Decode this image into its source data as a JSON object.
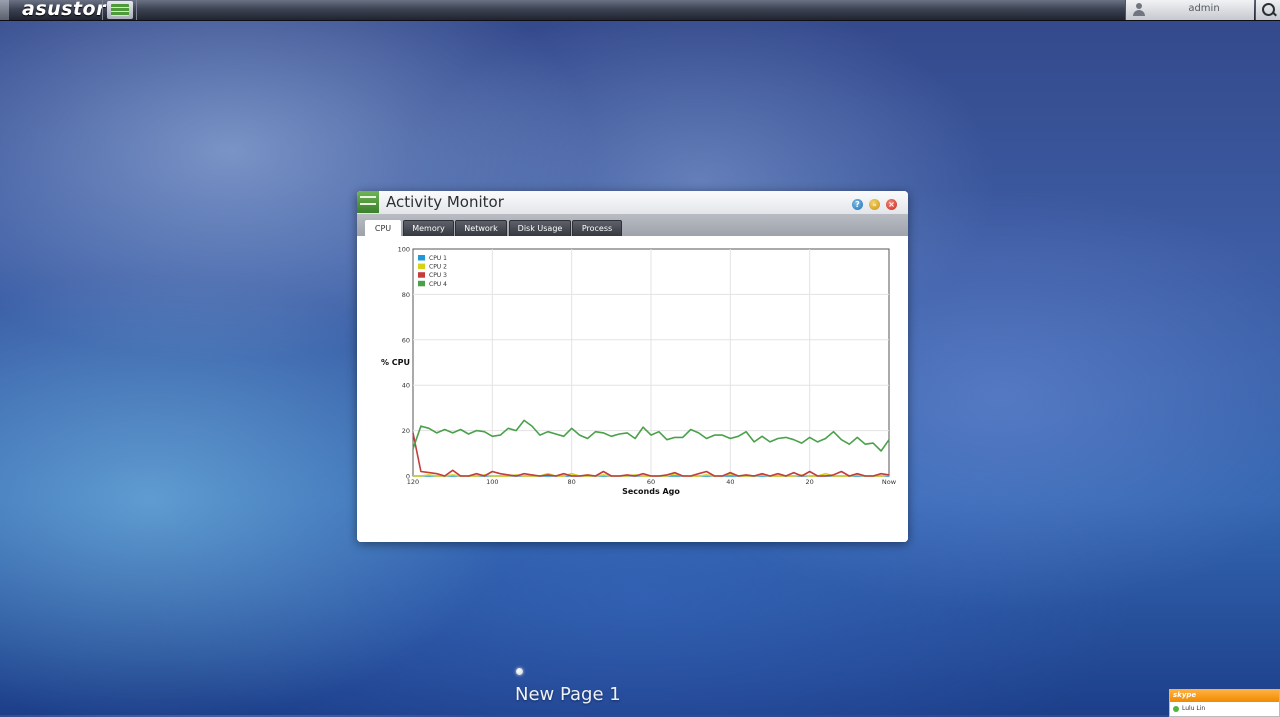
{
  "topbar": {
    "logo": "asustor",
    "username": "admin"
  },
  "window": {
    "title": "Activity Monitor",
    "tabs": [
      "CPU",
      "Memory",
      "Network",
      "Disk Usage",
      "Process"
    ],
    "active_tab": "CPU"
  },
  "desktop": {
    "page_name": "New Page 1"
  },
  "widget": {
    "brand": "skype",
    "contact": "Lulu Lin"
  },
  "colors": {
    "cpu1": "#1f9ad6",
    "cpu2": "#d8d11a",
    "cpu3": "#c43c3c",
    "cpu4": "#4aa14a"
  },
  "chart_data": {
    "type": "line",
    "ylabel": "% CPU",
    "xlabel": "Seconds Ago",
    "ylim": [
      0,
      100
    ],
    "xlim": [
      120,
      0
    ],
    "y_ticks": [
      "0",
      "20",
      "40",
      "60",
      "80",
      "100"
    ],
    "x_ticks": [
      {
        "value": 120,
        "label": "120"
      },
      {
        "value": 100,
        "label": "100"
      },
      {
        "value": 80,
        "label": "80"
      },
      {
        "value": 60,
        "label": "60"
      },
      {
        "value": 40,
        "label": "40"
      },
      {
        "value": 20,
        "label": "20"
      },
      {
        "value": 0,
        "label": "Now"
      }
    ],
    "grid": true,
    "legend_position": "top-left",
    "x": [
      120,
      118,
      116,
      114,
      112,
      110,
      108,
      106,
      104,
      102,
      100,
      98,
      96,
      94,
      92,
      90,
      88,
      86,
      84,
      82,
      80,
      78,
      76,
      74,
      72,
      70,
      68,
      66,
      64,
      62,
      60,
      58,
      56,
      54,
      52,
      50,
      48,
      46,
      44,
      42,
      40,
      38,
      36,
      34,
      32,
      30,
      28,
      26,
      24,
      22,
      20,
      18,
      16,
      14,
      12,
      10,
      8,
      6,
      4,
      2,
      0
    ],
    "series": [
      {
        "name": "CPU 1",
        "values": [
          0,
          0,
          0,
          0,
          0,
          0,
          0,
          0,
          0,
          0,
          0,
          0,
          0,
          0,
          0,
          0,
          0,
          0,
          0,
          0,
          0,
          0,
          0,
          0,
          0,
          0,
          0,
          0,
          0,
          0,
          0,
          0,
          0,
          0,
          0,
          0,
          0,
          0,
          0,
          0,
          0,
          0,
          0,
          0,
          0,
          0,
          0,
          0,
          0,
          0,
          0,
          0,
          0,
          0,
          0,
          0,
          0,
          0,
          0,
          0,
          0
        ]
      },
      {
        "name": "CPU 2",
        "values": [
          0,
          0,
          0.5,
          0,
          0,
          0.5,
          0,
          0,
          0,
          0.5,
          0,
          0,
          0,
          0.5,
          0,
          0,
          0,
          1,
          0,
          0,
          1,
          0,
          0,
          0,
          0.5,
          0,
          0,
          0,
          0.5,
          0,
          0,
          0,
          0,
          1,
          0,
          0,
          0,
          0.5,
          0,
          0,
          1,
          0,
          0,
          0,
          0.5,
          0,
          0,
          0,
          0,
          0.5,
          0,
          0,
          1,
          0,
          0,
          0,
          0.5,
          0,
          0,
          0,
          0.5
        ]
      },
      {
        "name": "CPU 3",
        "values": [
          19,
          2,
          1.5,
          1,
          0,
          2.5,
          0,
          0,
          1,
          0,
          2,
          1,
          0.5,
          0,
          1,
          0.5,
          0,
          0.5,
          0,
          1,
          0,
          0,
          0.5,
          0,
          2,
          0,
          0,
          0.5,
          0,
          1,
          0,
          0,
          0.5,
          1.5,
          0,
          0,
          1,
          2,
          0,
          0,
          1.5,
          0,
          0.5,
          0,
          1,
          0,
          1,
          0,
          1.5,
          0,
          2,
          0,
          0,
          0.5,
          2,
          0,
          1,
          0,
          0,
          1,
          0.5
        ]
      },
      {
        "name": "CPU 4",
        "values": [
          12,
          22,
          21,
          19,
          20.5,
          19,
          20.5,
          18.5,
          20,
          19.5,
          17.5,
          18,
          21,
          20,
          24.5,
          22,
          18,
          19.5,
          18.5,
          17.5,
          21,
          18,
          16.5,
          19.5,
          19,
          17.5,
          18.5,
          19,
          16.5,
          21.5,
          18,
          19.5,
          16,
          17,
          17,
          20.5,
          19,
          16.5,
          18,
          18,
          16.5,
          17.5,
          19.5,
          15,
          17.5,
          15,
          16.5,
          17,
          16,
          14.5,
          17,
          15,
          16.5,
          19.5,
          16,
          14,
          17,
          14,
          14.5,
          11,
          16
        ]
      }
    ]
  }
}
